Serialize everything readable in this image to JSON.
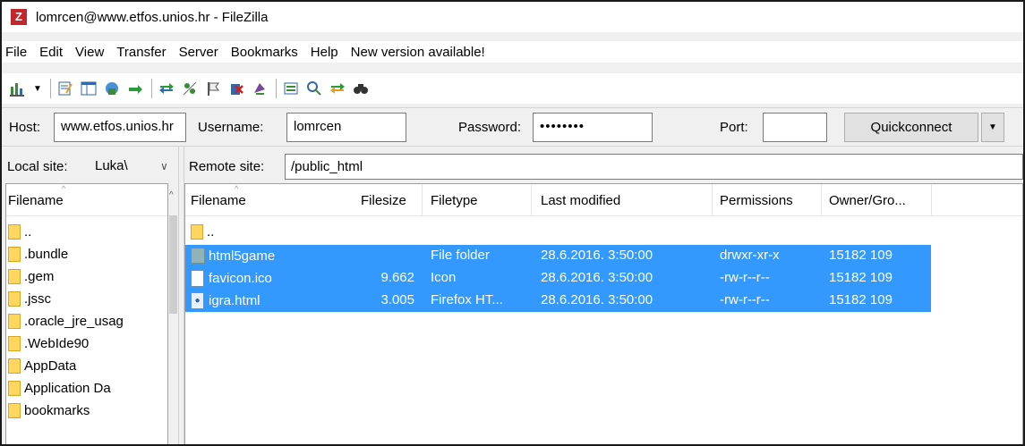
{
  "window": {
    "title": "lomrcen@www.etfos.unios.hr - FileZilla",
    "app_icon_letter": "Z"
  },
  "menu": [
    "File",
    "Edit",
    "View",
    "Transfer",
    "Server",
    "Bookmarks",
    "Help",
    "New version available!"
  ],
  "toolbar": {
    "icons": [
      "site-manager-icon",
      "dropdown-arrow-icon",
      "message-log-icon",
      "directory-tree-icon",
      "remote-tree-icon",
      "transfer-queue-icon",
      "refresh-icon",
      "process-queue-icon",
      "cancel-icon",
      "disconnect-icon",
      "reconnect-icon",
      "directory-filter-icon",
      "compare-icon",
      "sync-browse-icon",
      "search-icon"
    ]
  },
  "quickconnect": {
    "host_label": "Host:",
    "host_value": "www.etfos.unios.hr",
    "username_label": "Username:",
    "username_value": "lomrcen",
    "password_label": "Password:",
    "password_value": "••••••••",
    "port_label": "Port:",
    "port_value": "",
    "button_label": "Quickconnect"
  },
  "local": {
    "site_label": "Local site:",
    "site_value": "Luka\\",
    "header": "Filename",
    "items": [
      {
        "name": ".."
      },
      {
        "name": ".bundle"
      },
      {
        "name": ".gem"
      },
      {
        "name": ".jssc"
      },
      {
        "name": ".oracle_jre_usag"
      },
      {
        "name": ".WebIde90"
      },
      {
        "name": "AppData"
      },
      {
        "name": "Application Da"
      },
      {
        "name": "bookmarks"
      }
    ]
  },
  "remote": {
    "site_label": "Remote site:",
    "site_value": "/public_html",
    "headers": {
      "filename": "Filename",
      "filesize": "Filesize",
      "filetype": "Filetype",
      "last_modified": "Last modified",
      "permissions": "Permissions",
      "owner": "Owner/Gro..."
    },
    "parent": "..",
    "rows": [
      {
        "name": "html5game",
        "size": "",
        "type": "File folder",
        "modified": "28.6.2016. 3:50:00",
        "perms": "drwxr-xr-x",
        "owner": "15182 109",
        "icon": "folder"
      },
      {
        "name": "favicon.ico",
        "size": "9.662",
        "type": "Icon",
        "modified": "28.6.2016. 3:50:00",
        "perms": "-rw-r--r--",
        "owner": "15182 109",
        "icon": "file"
      },
      {
        "name": "igra.html",
        "size": "3.005",
        "type": "Firefox HT...",
        "modified": "28.6.2016. 3:50:00",
        "perms": "-rw-r--r--",
        "owner": "15182 109",
        "icon": "html"
      }
    ]
  },
  "colors": {
    "selection": "#3399ff",
    "folder": "#ffd760",
    "brand": "#c1272d"
  }
}
